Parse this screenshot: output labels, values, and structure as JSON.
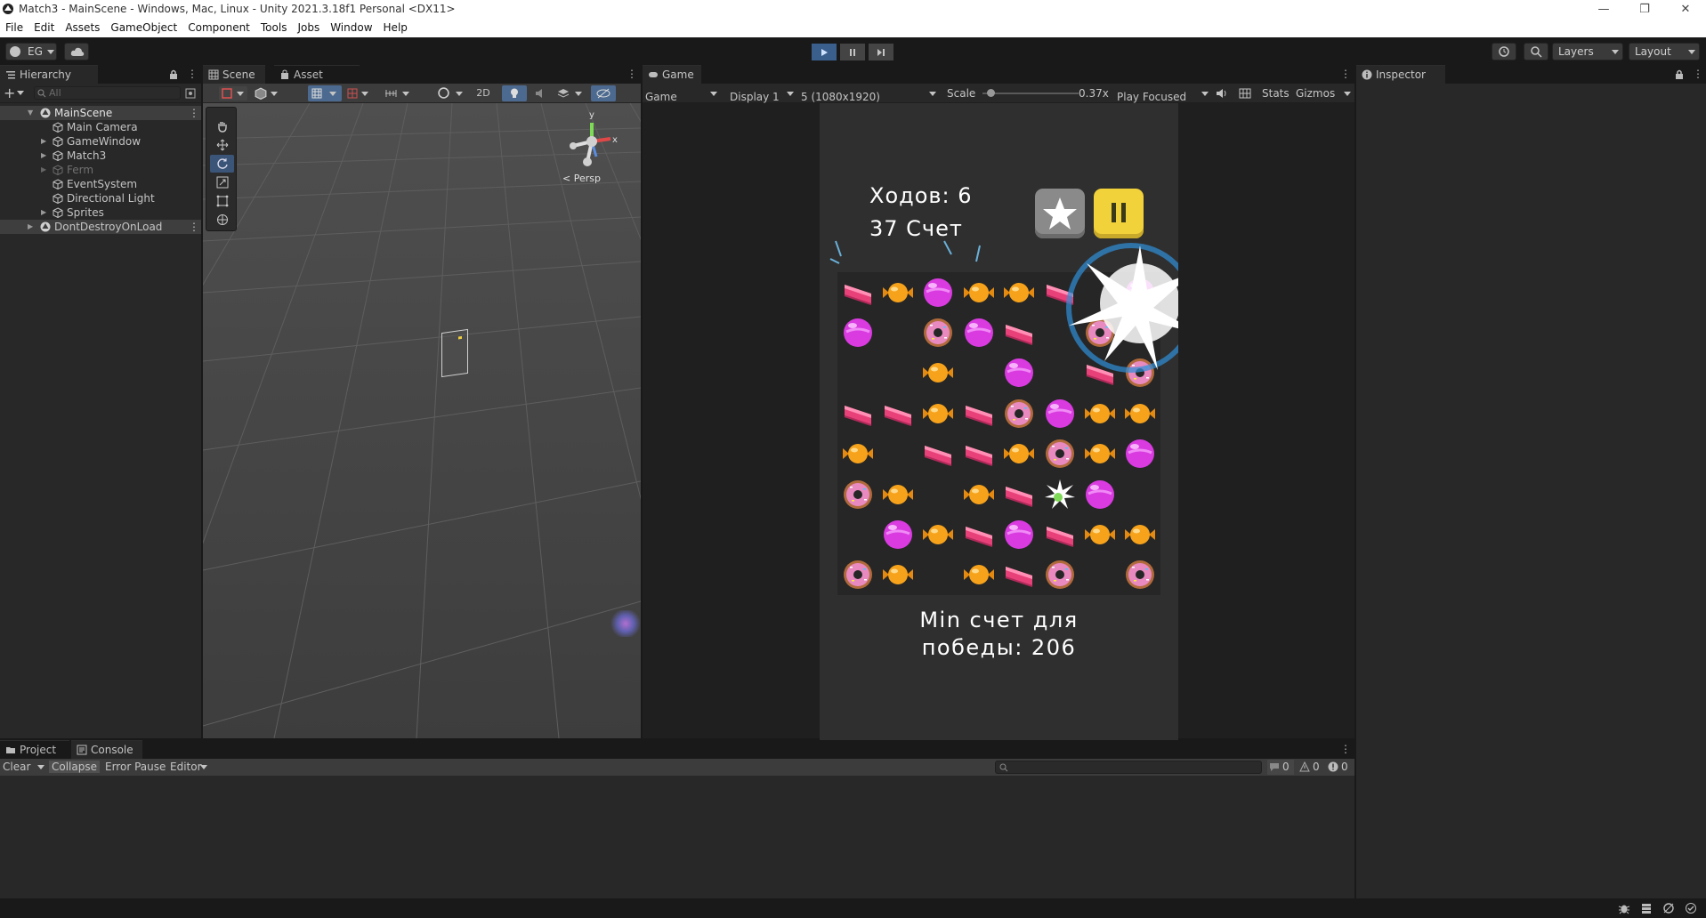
{
  "window": {
    "title": "Match3 - MainScene - Windows, Mac, Linux - Unity 2021.3.18f1 Personal <DX11>",
    "controls": [
      "—",
      "❐",
      "✕"
    ]
  },
  "menu": [
    "File",
    "Edit",
    "Assets",
    "GameObject",
    "Component",
    "Tools",
    "Jobs",
    "Window",
    "Help"
  ],
  "toolbar": {
    "account": "EG",
    "layers_label": "Layers",
    "layout_label": "Layout"
  },
  "hierarchy": {
    "tab": "Hierarchy",
    "search_placeholder": "All",
    "items": [
      {
        "label": "MainScene",
        "icon": "unity-scene-icon",
        "selected": true,
        "dim": false
      },
      {
        "label": "Main Camera",
        "icon": "gameobject-icon",
        "selected": false,
        "dim": false
      },
      {
        "label": "GameWindow",
        "icon": "gameobject-icon",
        "selected": false,
        "dim": false
      },
      {
        "label": "Match3",
        "icon": "gameobject-icon",
        "selected": false,
        "dim": false
      },
      {
        "label": "Ferm",
        "icon": "gameobject-icon",
        "selected": false,
        "dim": true
      },
      {
        "label": "EventSystem",
        "icon": "gameobject-icon",
        "selected": false,
        "dim": false
      },
      {
        "label": "Directional Light",
        "icon": "gameobject-icon",
        "selected": false,
        "dim": false
      },
      {
        "label": "Sprites",
        "icon": "gameobject-icon",
        "selected": false,
        "dim": false
      },
      {
        "label": "DontDestroyOnLoad",
        "icon": "unity-scene-icon",
        "selected": false,
        "dim": false
      }
    ]
  },
  "scene": {
    "tabs": [
      "Scene",
      "Asset Store"
    ],
    "toggle_2d": "2D",
    "persp_label": "< Persp",
    "gizmo_axes": {
      "y": "y",
      "x": "x"
    }
  },
  "game": {
    "tab": "Game",
    "view_select": "Game",
    "display_select": "Display 1",
    "resolution_select": "5 (1080x1920)",
    "scale_label": "Scale",
    "scale_value": "0.37x",
    "scale_fraction": 0.05,
    "play_mode_select": "Play Focused",
    "stats_label": "Stats",
    "gizmos_label": "Gizmos",
    "moves_text": "Ходов: 6",
    "score_text": "37 Счет",
    "min_score_line1": "Min счет для",
    "min_score_line2": "победы: 206",
    "board": [
      [
        "cake",
        "candy",
        "gum",
        "candy",
        "candy",
        "cake",
        "",
        "gum"
      ],
      [
        "gum",
        "",
        "donut",
        "gum",
        "cake",
        "",
        "donut",
        ""
      ],
      [
        "",
        "",
        "candy",
        "",
        "gum",
        "",
        "cake",
        "donut"
      ],
      [
        "cake",
        "cake",
        "candy",
        "cake",
        "donut",
        "gum",
        "candy",
        "candy"
      ],
      [
        "candy",
        "",
        "cake",
        "cake",
        "candy",
        "donut",
        "candy",
        "gum"
      ],
      [
        "donut",
        "candy",
        "",
        "candy",
        "cake",
        "burst",
        "gum",
        ""
      ],
      [
        "",
        "gum",
        "candy",
        "cake",
        "gum",
        "cake",
        "candy",
        "candy"
      ],
      [
        "donut",
        "candy",
        "",
        "candy",
        "cake",
        "donut",
        "",
        "donut"
      ]
    ],
    "colors": {
      "cake": "#e8417a",
      "candy": "#f7a21b",
      "gum": "#d93be0",
      "donut": "#b06a3b",
      "pause": "#f2d23a",
      "star_btn": "#8a8a8a"
    }
  },
  "inspector": {
    "tab": "Inspector"
  },
  "bottom": {
    "tabs": [
      "Project",
      "Console"
    ],
    "clear": "Clear",
    "collapse": "Collapse",
    "error_pause": "Error Pause",
    "editor": "Editor",
    "counts": [
      "0",
      "0",
      "0"
    ]
  }
}
